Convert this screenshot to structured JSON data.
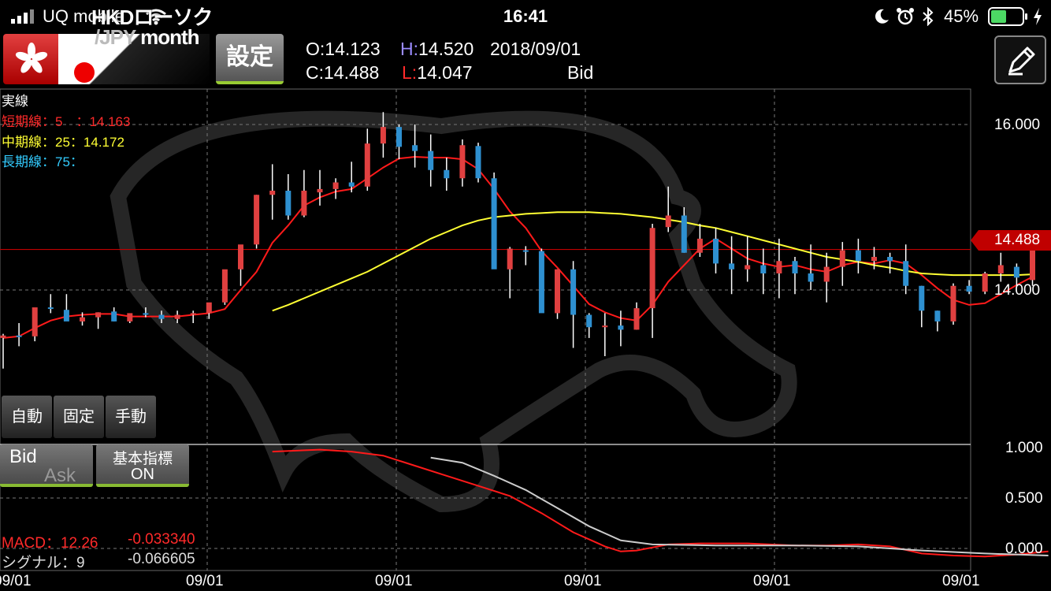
{
  "status_bar": {
    "carrier": "UQ mobile",
    "time": "16:41",
    "battery": "45%"
  },
  "header": {
    "pair_top": "HKDローソク",
    "pair_bottom_currency": "/JPY",
    "pair_bottom_period": "month",
    "settings_label": "設定",
    "open_label": "O:14.123",
    "high_prefix": "H:",
    "high_value": "14.520",
    "date": "2018/09/01",
    "close_label": "C:14.488",
    "low_prefix": "L:",
    "low_value": "14.047",
    "price_type": "Bid"
  },
  "legend": {
    "actual": "実線",
    "short": "短期線：5　：14.163",
    "mid": "中期線：25：14.172",
    "long": "長期線：75："
  },
  "controls": {
    "auto": "自動",
    "fixed": "固定",
    "manual": "手動",
    "bid": "Bid",
    "ask": "Ask",
    "indicator_label": "基本指標",
    "indicator_state": "ON"
  },
  "price_axis": {
    "current": "14.488",
    "labels": [
      "16.000",
      "14.000"
    ]
  },
  "macd_axis": {
    "labels": [
      "1.000",
      "0.500",
      "0.000"
    ]
  },
  "macd": {
    "macd_label": "MACD：12.26",
    "macd_value": "-0.033340",
    "signal_label": "シグナル：9",
    "signal_value": "-0.066605"
  },
  "date_axis": [
    "09/01",
    "09/01",
    "09/01",
    "09/01",
    "09/01",
    "09/01"
  ],
  "colors": {
    "up": "#e04040",
    "down": "#2e90d0",
    "short_ma": "#ff1a1a",
    "mid_ma": "#ffff33",
    "long_ma": "#33ccff",
    "signal": "#cccccc"
  },
  "chart_data": {
    "type": "candlestick",
    "period": "month",
    "y_price_range": [
      13.1,
      16.4
    ],
    "candles": [
      [
        13.42,
        13.47,
        13.05,
        13.45
      ],
      [
        13.45,
        13.6,
        13.32,
        13.44
      ],
      [
        13.44,
        13.78,
        13.38,
        13.79
      ],
      [
        13.79,
        13.95,
        13.72,
        13.78
      ],
      [
        13.76,
        13.95,
        13.65,
        13.62
      ],
      [
        13.62,
        13.73,
        13.57,
        13.67
      ],
      [
        13.67,
        13.73,
        13.53,
        13.73
      ],
      [
        13.74,
        13.79,
        13.62,
        13.62
      ],
      [
        13.62,
        13.68,
        13.6,
        13.72
      ],
      [
        13.72,
        13.79,
        13.67,
        13.7
      ],
      [
        13.7,
        13.75,
        13.6,
        13.65
      ],
      [
        13.65,
        13.75,
        13.6,
        13.7
      ],
      [
        13.7,
        13.75,
        13.6,
        13.72
      ],
      [
        13.72,
        13.8,
        13.65,
        13.85
      ],
      [
        13.85,
        14.2,
        13.82,
        14.25
      ],
      [
        14.25,
        14.52,
        14.05,
        14.55
      ],
      [
        14.55,
        15.15,
        14.5,
        15.15
      ],
      [
        15.15,
        15.52,
        14.85,
        15.2
      ],
      [
        15.2,
        15.4,
        14.85,
        14.9
      ],
      [
        14.9,
        15.45,
        14.88,
        15.2
      ],
      [
        15.18,
        15.45,
        15.02,
        15.22
      ],
      [
        15.22,
        15.35,
        15.1,
        15.3
      ],
      [
        15.3,
        15.55,
        15.18,
        15.25
      ],
      [
        15.25,
        15.95,
        15.2,
        15.77
      ],
      [
        15.77,
        16.15,
        15.6,
        15.97
      ],
      [
        15.97,
        16.0,
        15.58,
        15.73
      ],
      [
        15.75,
        16.0,
        15.48,
        15.68
      ],
      [
        15.68,
        15.88,
        15.25,
        15.45
      ],
      [
        15.45,
        15.6,
        15.2,
        15.35
      ],
      [
        15.35,
        15.82,
        15.25,
        15.75
      ],
      [
        15.74,
        15.78,
        15.3,
        15.35
      ],
      [
        15.35,
        15.42,
        14.75,
        14.25
      ],
      [
        14.25,
        14.52,
        13.9,
        14.5
      ],
      [
        14.48,
        14.53,
        14.3,
        14.47
      ],
      [
        14.47,
        14.5,
        13.75,
        13.72
      ],
      [
        13.72,
        14.25,
        13.65,
        14.25
      ],
      [
        14.25,
        14.35,
        13.3,
        13.7
      ],
      [
        13.7,
        13.72,
        13.42,
        13.55
      ],
      [
        13.55,
        13.72,
        13.2,
        13.57
      ],
      [
        13.57,
        13.75,
        13.32,
        13.52
      ],
      [
        13.52,
        13.85,
        13.52,
        13.78
      ],
      [
        13.78,
        14.8,
        13.42,
        14.75
      ],
      [
        14.76,
        15.25,
        14.7,
        14.9
      ],
      [
        14.9,
        15.0,
        14.45,
        14.45
      ],
      [
        14.45,
        14.8,
        14.4,
        14.62
      ],
      [
        14.62,
        14.75,
        14.2,
        14.32
      ],
      [
        14.32,
        14.65,
        13.95,
        14.25
      ],
      [
        14.25,
        14.65,
        14.1,
        14.3
      ],
      [
        14.3,
        14.5,
        13.95,
        14.2
      ],
      [
        14.2,
        14.62,
        13.9,
        14.35
      ],
      [
        14.35,
        14.4,
        13.95,
        14.2
      ],
      [
        14.2,
        14.55,
        14.0,
        14.1
      ],
      [
        14.1,
        14.45,
        13.85,
        14.28
      ],
      [
        14.28,
        14.58,
        14.05,
        14.48
      ],
      [
        14.48,
        14.62,
        14.2,
        14.35
      ],
      [
        14.35,
        14.52,
        14.25,
        14.4
      ],
      [
        14.4,
        14.45,
        14.2,
        14.35
      ],
      [
        14.35,
        14.55,
        13.95,
        14.05
      ],
      [
        14.05,
        14.05,
        13.55,
        13.75
      ],
      [
        13.75,
        13.75,
        13.5,
        13.62
      ],
      [
        13.62,
        14.08,
        13.58,
        14.05
      ],
      [
        14.05,
        14.12,
        13.95,
        13.98
      ],
      [
        13.98,
        14.22,
        13.95,
        14.2
      ],
      [
        14.2,
        14.45,
        14.1,
        14.3
      ],
      [
        14.28,
        14.32,
        14.05,
        14.15
      ],
      [
        14.12,
        14.52,
        14.05,
        14.49
      ]
    ],
    "ma_short": [
      13.42,
      13.44,
      13.54,
      13.63,
      13.68,
      13.7,
      13.71,
      13.71,
      13.68,
      13.68,
      13.68,
      13.68,
      13.7,
      13.72,
      13.77,
      14.0,
      14.22,
      14.57,
      14.78,
      15.02,
      15.12,
      15.19,
      15.22,
      15.35,
      15.48,
      15.59,
      15.61,
      15.6,
      15.6,
      15.58,
      15.46,
      15.22,
      14.95,
      14.75,
      14.47,
      14.27,
      14.05,
      13.83,
      13.73,
      13.66,
      13.63,
      13.82,
      14.1,
      14.3,
      14.5,
      14.62,
      14.5,
      14.38,
      14.32,
      14.28,
      14.3,
      14.25,
      14.22,
      14.3,
      14.34,
      14.32,
      14.36,
      14.32,
      14.18,
      14.02,
      13.88,
      13.82,
      13.84,
      13.95,
      14.06,
      14.16
    ],
    "ma_mid_start": 17,
    "ma_mid": [
      13.75,
      13.82,
      13.9,
      13.98,
      14.06,
      14.14,
      14.22,
      14.32,
      14.42,
      14.52,
      14.62,
      14.7,
      14.78,
      14.84,
      14.88,
      14.9,
      14.92,
      14.93,
      14.94,
      14.94,
      14.94,
      14.93,
      14.92,
      14.9,
      14.88,
      14.85,
      14.82,
      14.78,
      14.75,
      14.7,
      14.65,
      14.6,
      14.55,
      14.5,
      14.45,
      14.4,
      14.37,
      14.34,
      14.3,
      14.27,
      14.23,
      14.2,
      14.19,
      14.18,
      14.18,
      14.18,
      14.18,
      14.18,
      14.19
    ],
    "macd": [
      {
        "i": 17,
        "v": 0.96
      },
      {
        "i": 20,
        "v": 0.98
      },
      {
        "i": 22,
        "v": 0.96
      },
      {
        "i": 24,
        "v": 0.92
      },
      {
        "i": 26,
        "v": 0.82
      },
      {
        "i": 28,
        "v": 0.72
      },
      {
        "i": 30,
        "v": 0.62
      },
      {
        "i": 32,
        "v": 0.52
      },
      {
        "i": 34,
        "v": 0.35
      },
      {
        "i": 36,
        "v": 0.16
      },
      {
        "i": 38,
        "v": 0.02
      },
      {
        "i": 39,
        "v": -0.03
      },
      {
        "i": 40,
        "v": -0.02
      },
      {
        "i": 42,
        "v": 0.04
      },
      {
        "i": 44,
        "v": 0.05
      },
      {
        "i": 47,
        "v": 0.05
      },
      {
        "i": 50,
        "v": 0.03
      },
      {
        "i": 52,
        "v": 0.03
      },
      {
        "i": 54,
        "v": 0.04
      },
      {
        "i": 56,
        "v": 0.02
      },
      {
        "i": 58,
        "v": -0.05
      },
      {
        "i": 60,
        "v": -0.07
      },
      {
        "i": 62,
        "v": -0.08
      },
      {
        "i": 64,
        "v": -0.06
      },
      {
        "i": 66,
        "v": -0.03
      }
    ],
    "signal": [
      {
        "i": 27,
        "v": 0.9
      },
      {
        "i": 29,
        "v": 0.85
      },
      {
        "i": 31,
        "v": 0.72
      },
      {
        "i": 33,
        "v": 0.58
      },
      {
        "i": 35,
        "v": 0.4
      },
      {
        "i": 37,
        "v": 0.22
      },
      {
        "i": 39,
        "v": 0.08
      },
      {
        "i": 41,
        "v": 0.04
      },
      {
        "i": 45,
        "v": 0.03
      },
      {
        "i": 50,
        "v": 0.03
      },
      {
        "i": 54,
        "v": 0.02
      },
      {
        "i": 58,
        "v": -0.02
      },
      {
        "i": 62,
        "v": -0.05
      },
      {
        "i": 66,
        "v": -0.07
      }
    ],
    "macd_range": [
      -0.1,
      1.1
    ]
  }
}
